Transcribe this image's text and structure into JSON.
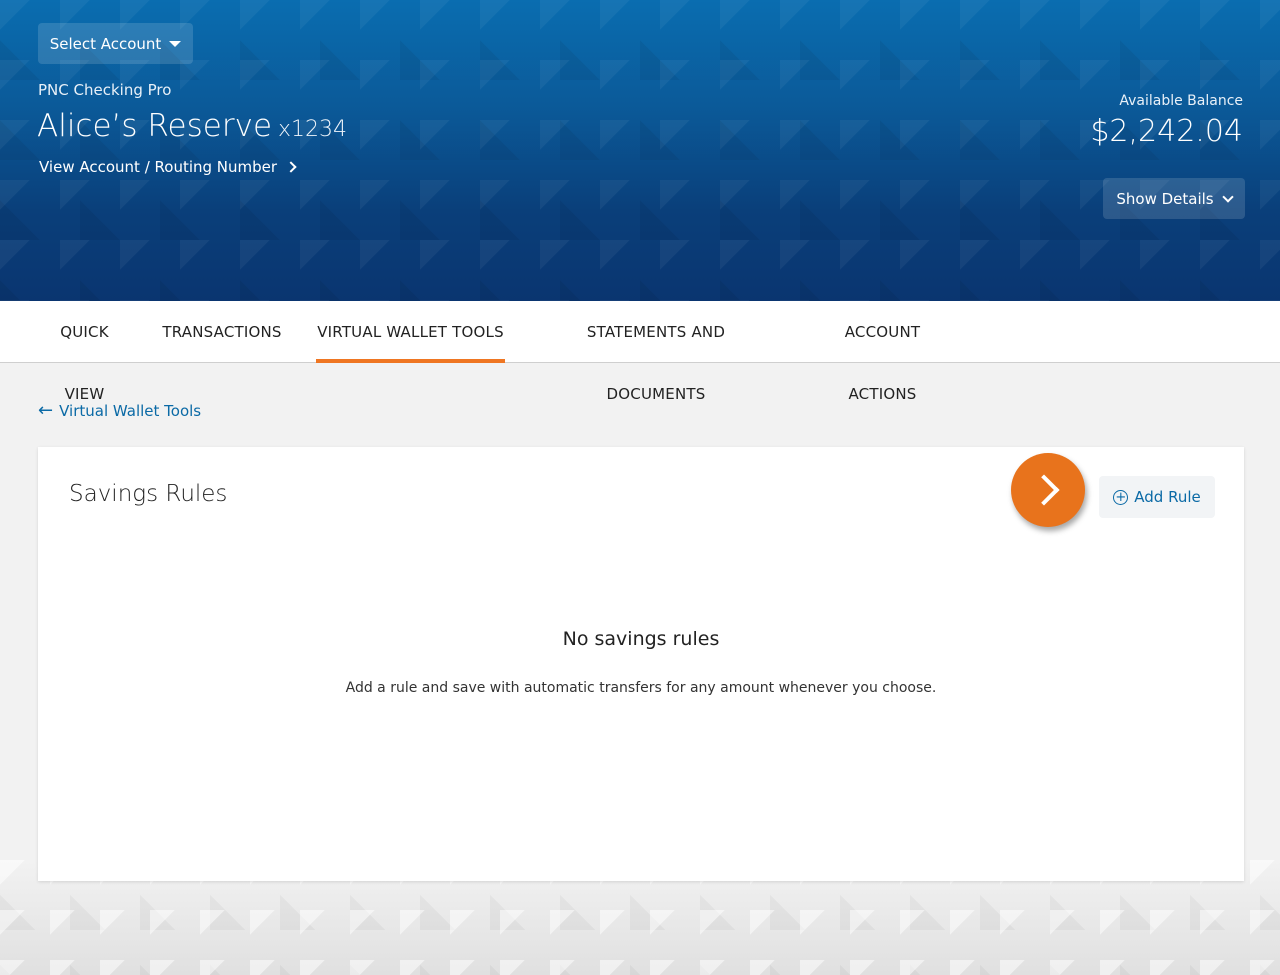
{
  "header": {
    "select_account_label": "Select Account",
    "product_name": "PNC Checking Pro",
    "account_name": "Alice’s Reserve",
    "account_suffix": "x1234",
    "view_routing_label": "View Account / Routing Number",
    "available_balance_label": "Available Balance",
    "available_balance_value": "$2,242.04",
    "show_details_label": "Show Details"
  },
  "tabs": [
    {
      "label": "QUICK VIEW",
      "active": false
    },
    {
      "label": "TRANSACTIONS",
      "active": false
    },
    {
      "label": "VIRTUAL WALLET TOOLS",
      "active": true
    },
    {
      "label": "STATEMENTS AND DOCUMENTS",
      "active": false
    },
    {
      "label": "ACCOUNT ACTIONS",
      "active": false
    }
  ],
  "back_link": {
    "icon": "arrow-left-icon",
    "label": "Virtual Wallet Tools"
  },
  "card": {
    "title": "Savings Rules",
    "add_rule_label": "Add Rule",
    "empty_title": "No savings rules",
    "empty_description": "Add a rule and save with automatic transfers for any amount whenever you choose."
  },
  "colors": {
    "accent": "#ef7622",
    "link": "#0b6aa6",
    "header_blue": "#0a4f8c"
  }
}
